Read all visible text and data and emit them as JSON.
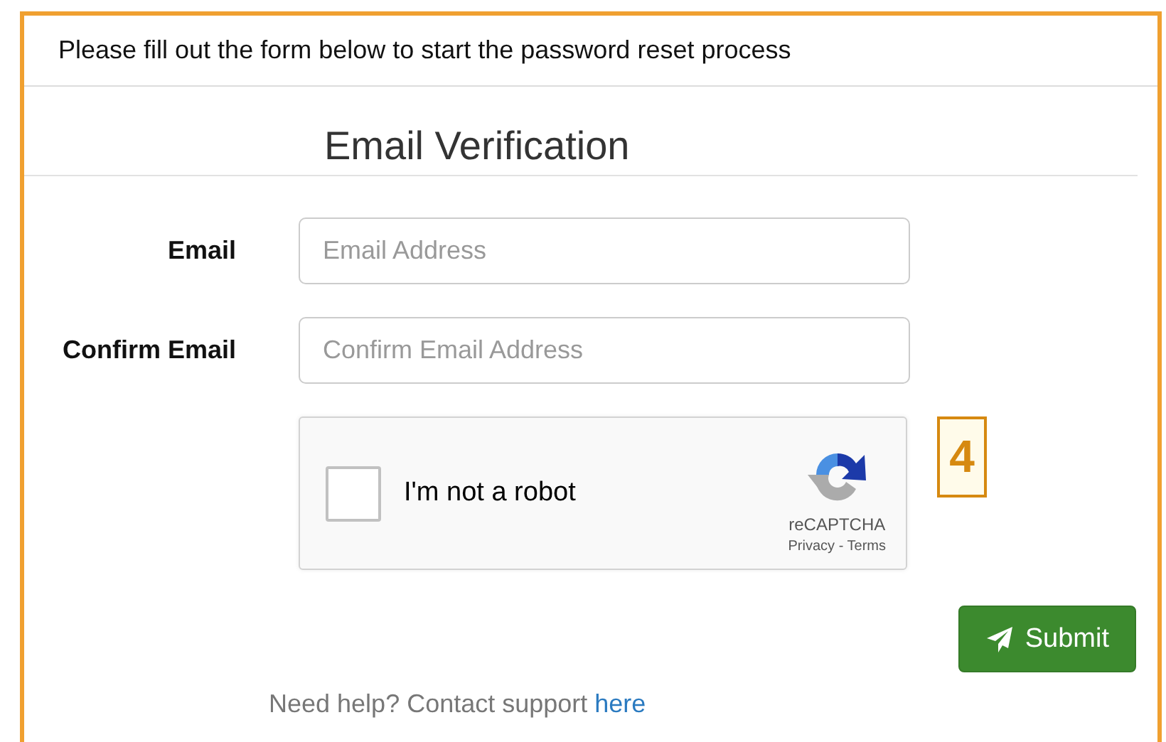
{
  "intro": "Please fill out the form below to start the password reset process",
  "heading": "Email Verification",
  "fields": [
    {
      "label": "Email",
      "placeholder": "Email Address"
    },
    {
      "label": "Confirm Email",
      "placeholder": "Confirm Email Address"
    }
  ],
  "captcha": {
    "label": "I'm not a robot",
    "checked": false,
    "brand": "reCAPTCHA",
    "privacy_link": "Privacy",
    "separator": "-",
    "terms_link": "Terms"
  },
  "annotation": "4",
  "submit": "Submit",
  "help": {
    "text": "Need help? Contact support",
    "link": "here"
  }
}
